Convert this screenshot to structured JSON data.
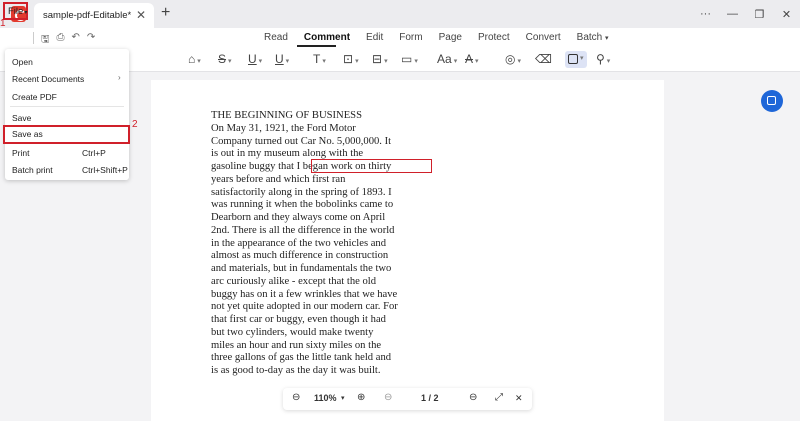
{
  "window": {
    "tab_title": "sample-pdf-Editable*",
    "tab_close_glyph": "✕",
    "new_tab_glyph": "+",
    "more_glyph": "···",
    "minimize_glyph": "—",
    "maximize_glyph": "❐",
    "close_glyph": "✕"
  },
  "menubar": {
    "file_label": "File",
    "file_caret": "▾",
    "tabs": [
      "Read",
      "Comment",
      "Edit",
      "Form",
      "Page",
      "Protect",
      "Convert",
      "Batch"
    ],
    "batch_caret": "▾",
    "active_tab": "Comment"
  },
  "annotations": {
    "step1": "1",
    "step2": "2"
  },
  "file_menu": {
    "items": [
      {
        "label": "Open",
        "shortcut": ""
      },
      {
        "label": "Recent Documents",
        "shortcut": "",
        "arrow": "›"
      },
      {
        "label": "Create PDF",
        "shortcut": ""
      },
      {
        "label": "Save",
        "shortcut": ""
      },
      {
        "label": "Save as",
        "shortcut": ""
      },
      {
        "label": "Print",
        "shortcut": "Ctrl+P"
      },
      {
        "label": "Batch print",
        "shortcut": "Ctrl+Shift+P"
      }
    ]
  },
  "document": {
    "lines": [
      "THE BEGINNING OF BUSINESS",
      "On May 31, 1921, the Ford Motor",
      "Company turned out Car No. 5,000,000. It",
      "is out in my museum along with the",
      "gasoline buggy that I began work on thirty",
      "years before and which first ran",
      "satisfactorily along in the spring of 1893. I",
      "was running it when the bobolinks came to",
      "Dearborn and they always come on April",
      "2nd. There is all the difference in the world",
      "in the appearance of the two vehicles and",
      "almost as much difference in construction",
      "and materials, but in fundamentals the two",
      "arc curiously alike - except that the old",
      "buggy has on it a few wrinkles that we have",
      "not yet quite adopted in our modern car. For",
      "that first car or buggy, even though it had",
      "but two cylinders, would make twenty",
      "miles an hour and run sixty miles on the",
      "three gallons of gas the little tank held and",
      "is as good to-day as the day it was built."
    ]
  },
  "zoombar": {
    "zoom_out_glyph": "⊖",
    "zoom_value": "110%",
    "zoom_caret": "▾",
    "zoom_in_glyph": "⊕",
    "prev_glyph": "⊖",
    "page_indicator": "1 / 2",
    "next_glyph": "⊖",
    "fit_glyph": "⤢",
    "close_glyph": "✕"
  }
}
